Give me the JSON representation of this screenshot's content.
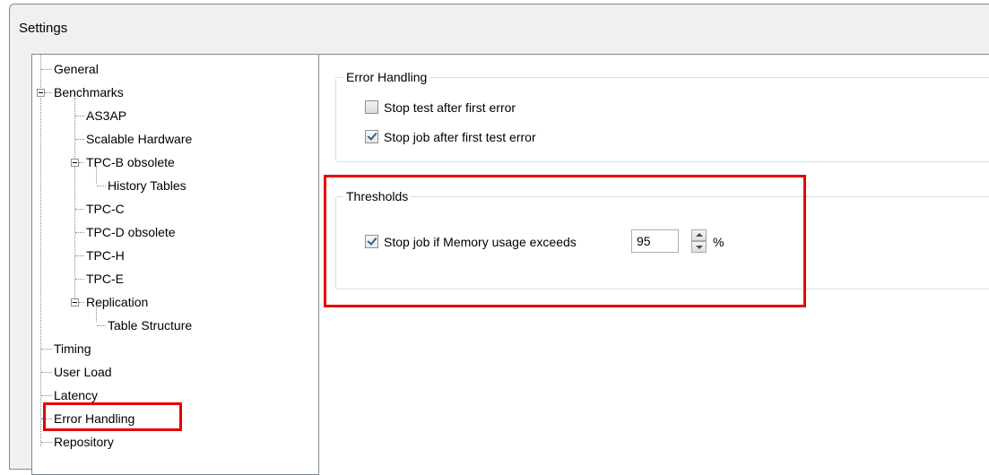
{
  "window": {
    "title": "Settings"
  },
  "tree": {
    "items": [
      {
        "label": "General"
      },
      {
        "label": "Benchmarks"
      },
      {
        "label": "AS3AP"
      },
      {
        "label": "Scalable Hardware"
      },
      {
        "label": "TPC-B obsolete"
      },
      {
        "label": "History Tables"
      },
      {
        "label": "TPC-C"
      },
      {
        "label": "TPC-D obsolete"
      },
      {
        "label": "TPC-H"
      },
      {
        "label": "TPC-E"
      },
      {
        "label": "Replication"
      },
      {
        "label": "Table Structure"
      },
      {
        "label": "Timing"
      },
      {
        "label": "User Load"
      },
      {
        "label": "Latency"
      },
      {
        "label": "Error Handling"
      },
      {
        "label": "Repository"
      }
    ],
    "selected": "Error Handling"
  },
  "error_handling": {
    "title": "Error Handling",
    "stop_test": {
      "label": "Stop test after first error",
      "checked": false
    },
    "stop_job": {
      "label": "Stop job after first test error",
      "checked": true
    }
  },
  "thresholds": {
    "title": "Thresholds",
    "memory": {
      "label": "Stop job if Memory usage exceeds",
      "checked": true,
      "value": "95",
      "unit": "%"
    }
  },
  "colors": {
    "highlight": "#e60000",
    "window_bg": "#f0f0f0",
    "check_mark": "#3a5a8c"
  }
}
